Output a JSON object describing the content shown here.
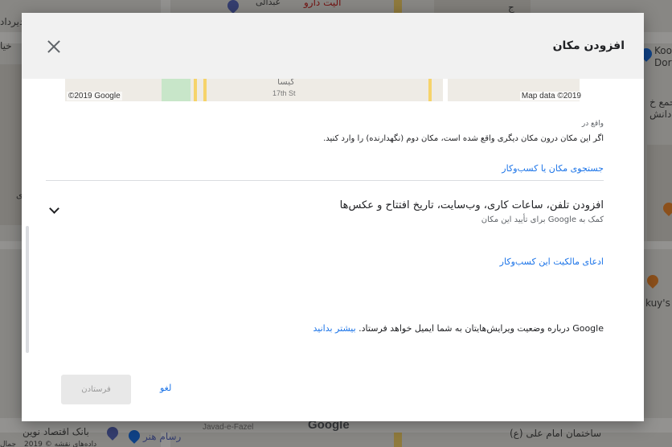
{
  "dialog": {
    "title": "افزودن مکان",
    "close_icon": "close-icon"
  },
  "map_preview": {
    "copyright": "©2019 Google",
    "map_data": "Map data ©2019",
    "street_label": "17th St",
    "place_label": "کیسا"
  },
  "located_in": {
    "label": "واقع در",
    "description": "اگر این مکان درون مکان دیگری واقع شده است، مکان دوم (نگهدارنده) را وارد کنید.",
    "search_link": "جستجوی مکان یا کسب‌وکار"
  },
  "expand_section": {
    "title": "افزودن تلفن، ساعات کاری، وب‌سایت، تاریخ افتتاح و عکس‌ها",
    "subtitle": "کمک به Google برای تأیید این مکان",
    "icon": "chevron-down-icon"
  },
  "claim_link": "ادعای مالکیت این کسب‌وکار",
  "notice": {
    "text": "Google درباره وضعیت ویرایش‌هایتان به شما ایمیل خواهد فرستاد.",
    "learn_more": "بیشتر بدانید"
  },
  "footer": {
    "send_label": "فرستادن",
    "cancel_label": "لغو"
  },
  "background": {
    "top_labels": [
      "دیرداد",
      "الیت دارو",
      "عبدالی",
      "ج"
    ],
    "right_labels": [
      "Koo",
      "Dor",
      "جمع خ",
      "دانش",
      "kuy's"
    ],
    "bottom_labels": [
      "بانک اقتصاد نوین",
      "رسام هنر",
      "Javad-e-Fazel",
      "Google",
      "ساختمان امام علی (ع)",
      "داده‌های نقشه © 2019",
      "جمال"
    ],
    "left_labels": [
      "خیا",
      "ی"
    ]
  },
  "colors": {
    "accent": "#1a73e8",
    "header_bg": "#f1f1f1",
    "scrim": "rgba(0,0,0,0.42)"
  }
}
